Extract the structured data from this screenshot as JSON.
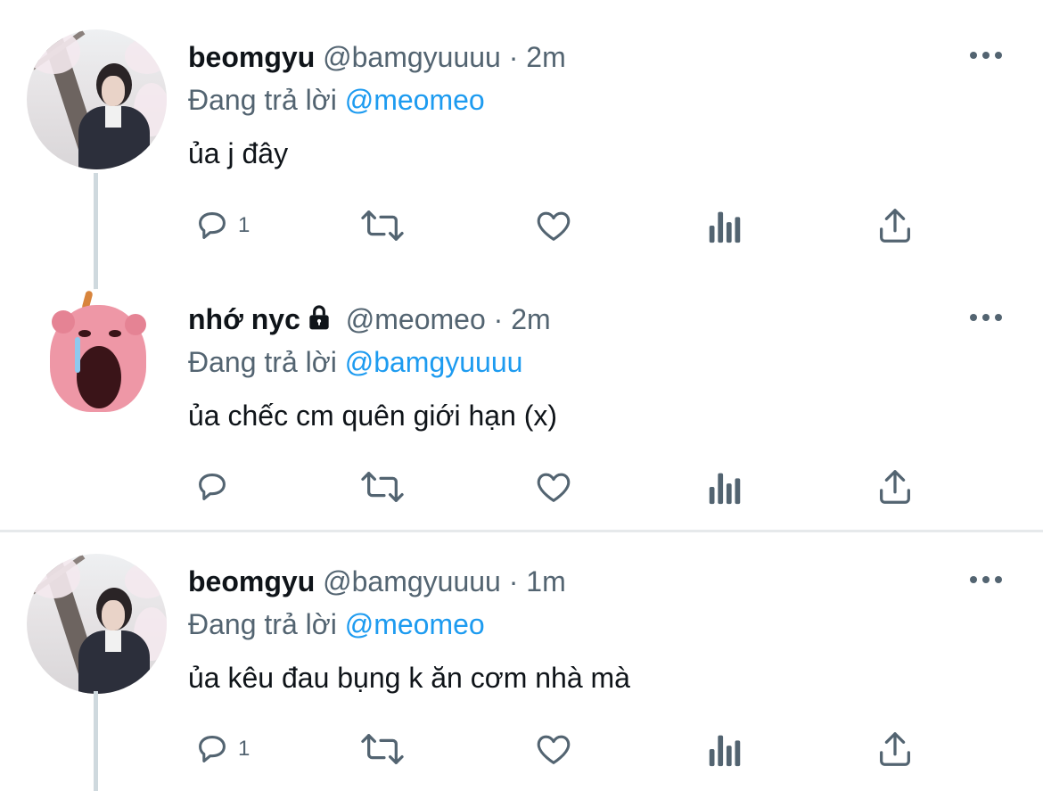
{
  "tweets": [
    {
      "name": "beomgyu",
      "handle": "@bamgyuuuu",
      "separator": "·",
      "time": "2m",
      "reply_prefix": "Đang trả lời",
      "reply_to": "@meomeo",
      "text": "ủa j đây",
      "reply_count": "1",
      "locked": false,
      "avatar": "photo-avatar"
    },
    {
      "name": "nhớ nyc",
      "handle": "@meomeo",
      "separator": "·",
      "time": "2m",
      "reply_prefix": "Đang trả lời",
      "reply_to": "@bamgyuuuu",
      "text": "ủa chếc cm quên giới hạn (x)",
      "reply_count": "",
      "locked": true,
      "avatar": "mascot-avatar"
    },
    {
      "name": "beomgyu",
      "handle": "@bamgyuuuu",
      "separator": "·",
      "time": "1m",
      "reply_prefix": "Đang trả lời",
      "reply_to": "@meomeo",
      "text": "ủa kêu đau bụng k ăn cơm nhà mà",
      "reply_count": "1",
      "locked": false,
      "avatar": "photo-avatar"
    }
  ],
  "icons": {
    "reply": "reply-icon",
    "retweet": "retweet-icon",
    "like": "heart-icon",
    "analytics": "analytics-icon",
    "share": "share-icon",
    "more": "more-icon",
    "lock": "lock-icon"
  },
  "colors": {
    "text": "#0f1419",
    "secondary": "#536471",
    "accent": "#1d9bf0",
    "thread_line": "#cfd9de",
    "divider": "#e6e9eb"
  }
}
